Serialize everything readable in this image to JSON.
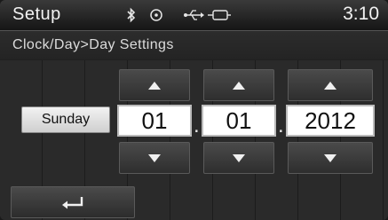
{
  "header": {
    "title": "Setup",
    "clock": "3:10",
    "icons": [
      "bluetooth-icon",
      "disc-icon",
      "usb-icon",
      "aux-icon"
    ]
  },
  "breadcrumb": "Clock/Day>Day Settings",
  "day": {
    "label": "Sunday"
  },
  "date": {
    "month": "01",
    "separator1": ".",
    "day": "01",
    "separator2": ".",
    "year": "2012"
  },
  "controls": {
    "up_icon": "up-arrow-icon",
    "down_icon": "down-arrow-icon",
    "back_icon": "back-arrow-icon"
  },
  "colors": {
    "text": "#f2f2f2",
    "field_bg": "#ffffff",
    "button_bg": "#3c3c3c"
  }
}
